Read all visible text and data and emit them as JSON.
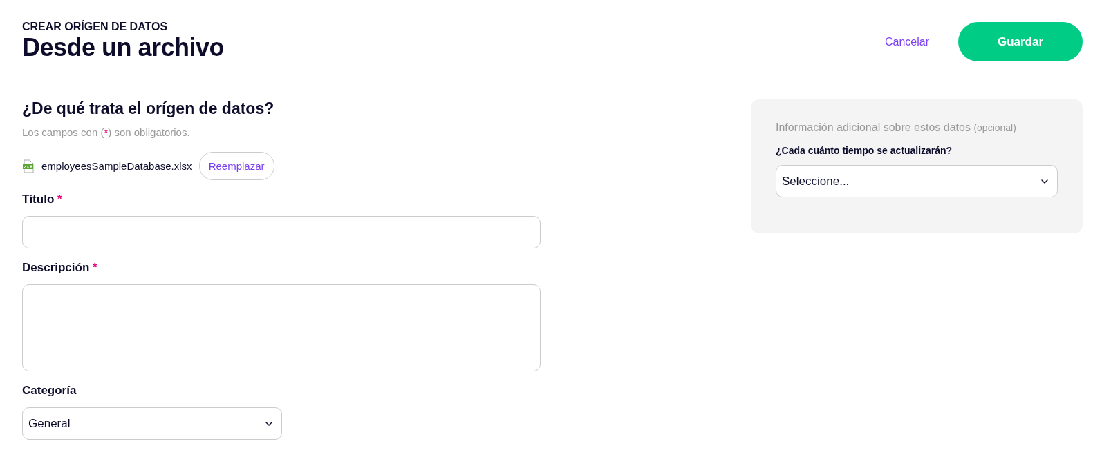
{
  "header": {
    "eyebrow": "CREAR ORÍGEN DE DATOS",
    "title": "Desde un archivo",
    "cancel": "Cancelar",
    "save": "Guardar"
  },
  "form": {
    "heading": "¿De qué trata el orígen de datos?",
    "note_before": "Los campos con (",
    "note_mark": "*",
    "note_after": ") son obligatorios.",
    "file": {
      "name": "employeesSampleDatabase.xlsx",
      "replace": "Reemplazar"
    },
    "fields": [
      {
        "kind": "input",
        "label": "Título",
        "required_mark": "*"
      },
      {
        "kind": "textarea",
        "label": "Descripción",
        "required_mark": "*"
      },
      {
        "kind": "select",
        "label": "Categoría",
        "value": "General"
      }
    ]
  },
  "panel": {
    "title": "Información adicional sobre estos datos",
    "title_suffix": "(opcional)",
    "question": "¿Cada cuánto tiempo se actualizarán?",
    "value": "Seleccione..."
  }
}
